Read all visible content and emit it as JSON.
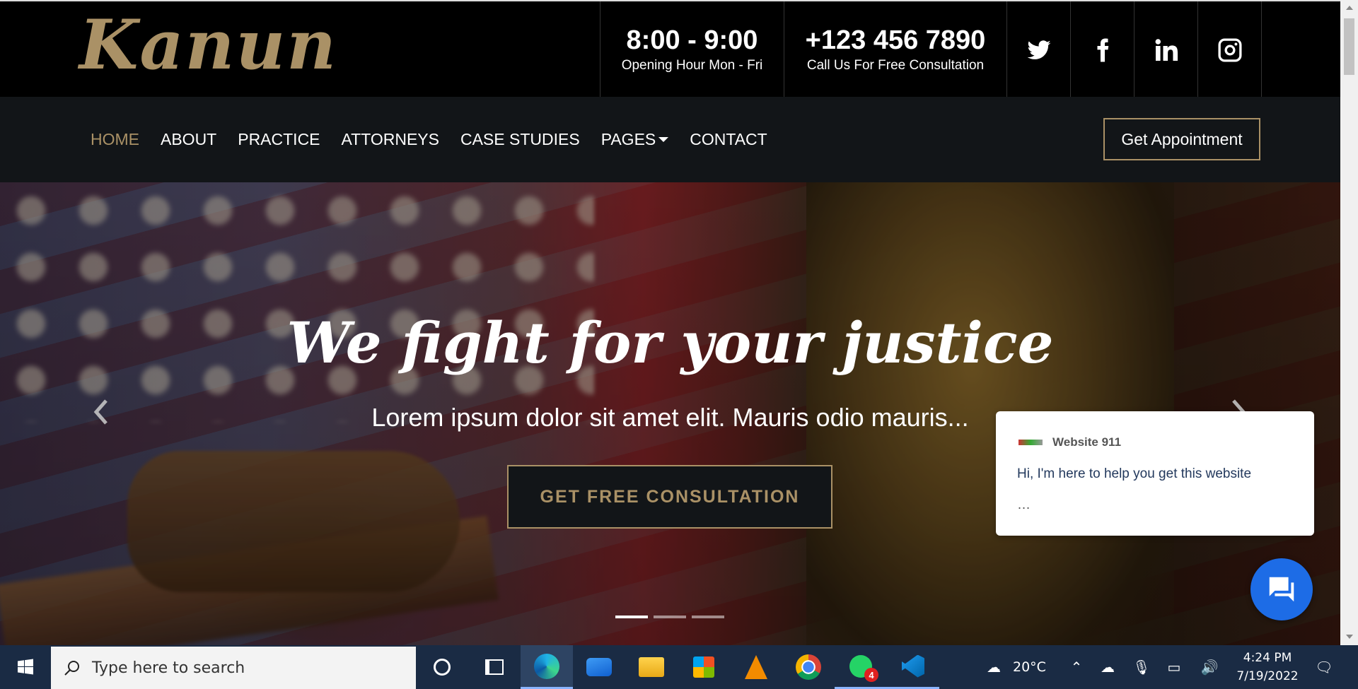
{
  "brand": {
    "logo_text": "Kanun",
    "accent_color": "#aa9166"
  },
  "topbar": {
    "hours": {
      "value": "8:00 - 9:00",
      "label": "Opening Hour Mon - Fri"
    },
    "phone": {
      "value": "+123 456 7890",
      "label": "Call Us For Free Consultation"
    },
    "social_icons": [
      "twitter-icon",
      "facebook-icon",
      "linkedin-icon",
      "instagram-icon"
    ]
  },
  "nav": {
    "items": [
      {
        "label": "HOME",
        "active": true
      },
      {
        "label": "ABOUT"
      },
      {
        "label": "PRACTICE"
      },
      {
        "label": "ATTORNEYS"
      },
      {
        "label": "CASE STUDIES"
      },
      {
        "label": "PAGES",
        "has_dropdown": true
      },
      {
        "label": "CONTACT"
      }
    ],
    "cta_label": "Get Appointment"
  },
  "hero": {
    "title": "We fight for your justice",
    "subtitle": "Lorem ipsum dolor sit amet elit. Mauris odio mauris...",
    "button_label": "GET FREE CONSULTATION",
    "slides": 3,
    "active_slide": 1
  },
  "chat": {
    "name": "Website 911",
    "message": "Hi, I'm here to help you get this website",
    "ellipsis": "…",
    "fab_color": "#1d6ce6"
  },
  "taskbar": {
    "search_placeholder": "Type here to search",
    "apps": [
      "cortana-icon",
      "task-view-icon",
      "edge-icon",
      "mail-icon",
      "file-explorer-icon",
      "store-icon",
      "vlc-icon",
      "chrome-icon",
      "whatsapp-icon",
      "vscode-icon"
    ],
    "whatsapp_badge": "4",
    "weather": "20°C",
    "time": "4:24 PM",
    "date": "7/19/2022"
  }
}
